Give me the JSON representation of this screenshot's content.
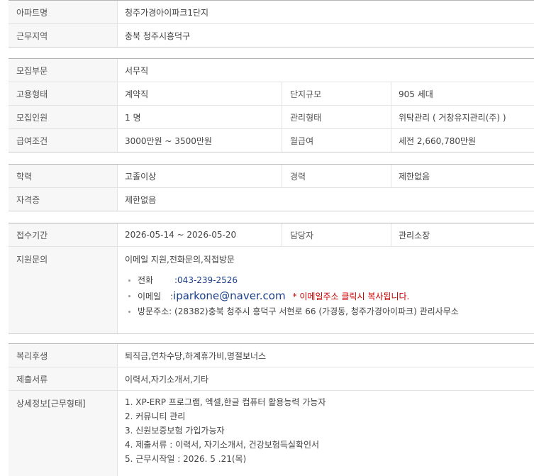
{
  "section1": {
    "apt_label": "아파트명",
    "apt_value": "청주가경아이파크1단지",
    "region_label": "근무지역",
    "region_value": "충북  청주시흥덕구"
  },
  "section2": {
    "dept_label": "모집부문",
    "dept_value": "서무직",
    "employ_label": "고용형태",
    "employ_value": "계약직",
    "scale_label": "단지규모",
    "scale_value": "905 세대",
    "count_label": "모집인원",
    "count_value": "1 명",
    "manage_label": "관리형태",
    "manage_value": "위탁관리 ( 거창유지관리(주) )",
    "salary_label": "급여조건",
    "salary_value": "3000만원 ~ 3500만원",
    "monthly_label": "월급여",
    "monthly_value": "세전 2,660,780만원"
  },
  "section3": {
    "edu_label": "학력",
    "edu_value": "고졸이상",
    "career_label": "경력",
    "career_value": "제한없음",
    "cert_label": "자격증",
    "cert_value": "제한없음"
  },
  "section4": {
    "period_label": "접수기간",
    "period_value": "2026-05-14 ~ 2026-05-20",
    "manager_label": "담당자",
    "manager_value": "관리소장",
    "inquiry_label": "지원문의",
    "inquiry_value": "이메일 지원,전화문의,직접방문",
    "phone_label": "전화",
    "phone_value": ":043-239-2526",
    "email_label": "이메일",
    "email_sep": ":",
    "email_value": "iparkone@naver.com",
    "email_note": "* 이메일주소 클릭시 복사됩니다.",
    "visit_label": "방문주소",
    "visit_value": ": (28382)충북 청주시 흥덕구 서현로 66 (가경동, 청주가경아이파크) 관리사무소"
  },
  "section5": {
    "welfare_label": "복리후생",
    "welfare_value": "퇴직금,연차수당,하계휴가비,명절보너스",
    "docs_label": "제출서류",
    "docs_value": "이력서,자기소개서,기타",
    "detail_label": "상세정보[근무형태]",
    "detail_lines": [
      "1. XP-ERP 프로그램, 엑셀,한글 컴퓨터 활용능력 가능자",
      "2. 커뮤니티 관리",
      "3. 신원보증보험 가입가능자",
      "4. 제출서류 : 이력서, 자기소개서, 건강보험득실확인서",
      "5. 근무시작일 : 2026. 5 .21(목)"
    ]
  }
}
